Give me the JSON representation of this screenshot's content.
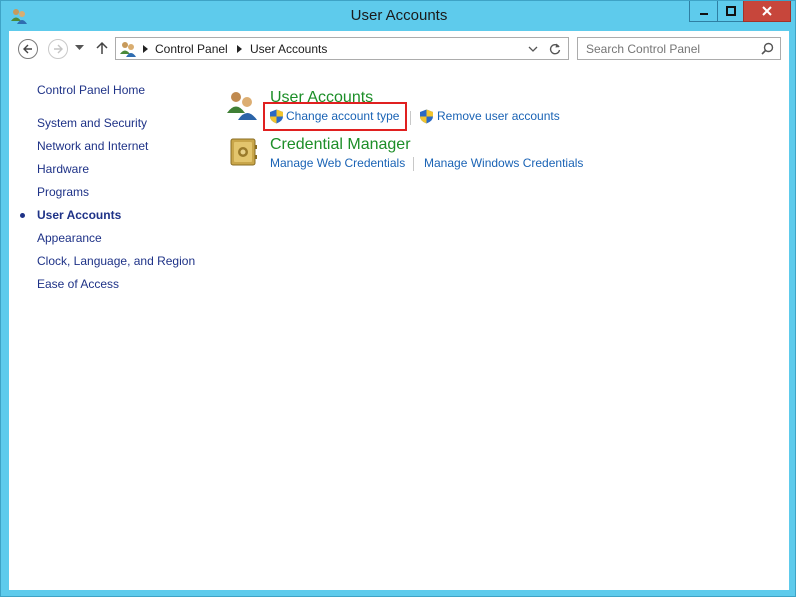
{
  "window": {
    "title": "User Accounts"
  },
  "address": {
    "crumbs": [
      "Control Panel",
      "User Accounts"
    ]
  },
  "search": {
    "placeholder": "Search Control Panel"
  },
  "sidebar": {
    "home": "Control Panel Home",
    "items": [
      {
        "label": "System and Security",
        "current": false
      },
      {
        "label": "Network and Internet",
        "current": false
      },
      {
        "label": "Hardware",
        "current": false
      },
      {
        "label": "Programs",
        "current": false
      },
      {
        "label": "User Accounts",
        "current": true
      },
      {
        "label": "Appearance",
        "current": false
      },
      {
        "label": "Clock, Language, and Region",
        "current": false
      },
      {
        "label": "Ease of Access",
        "current": false
      }
    ]
  },
  "main": {
    "categories": [
      {
        "title": "User Accounts",
        "icon": "users-icon",
        "tasks": [
          "Change account type",
          "Remove user accounts"
        ]
      },
      {
        "title": "Credential Manager",
        "icon": "vault-icon",
        "tasks": [
          "Manage Web Credentials",
          "Manage Windows Credentials"
        ]
      }
    ]
  },
  "colors": {
    "frame": "#5ecbec",
    "link": "#1a63b5",
    "category": "#1c8e28",
    "nav": "#1e3287",
    "highlight": "#e02020",
    "close": "#c7463b"
  }
}
